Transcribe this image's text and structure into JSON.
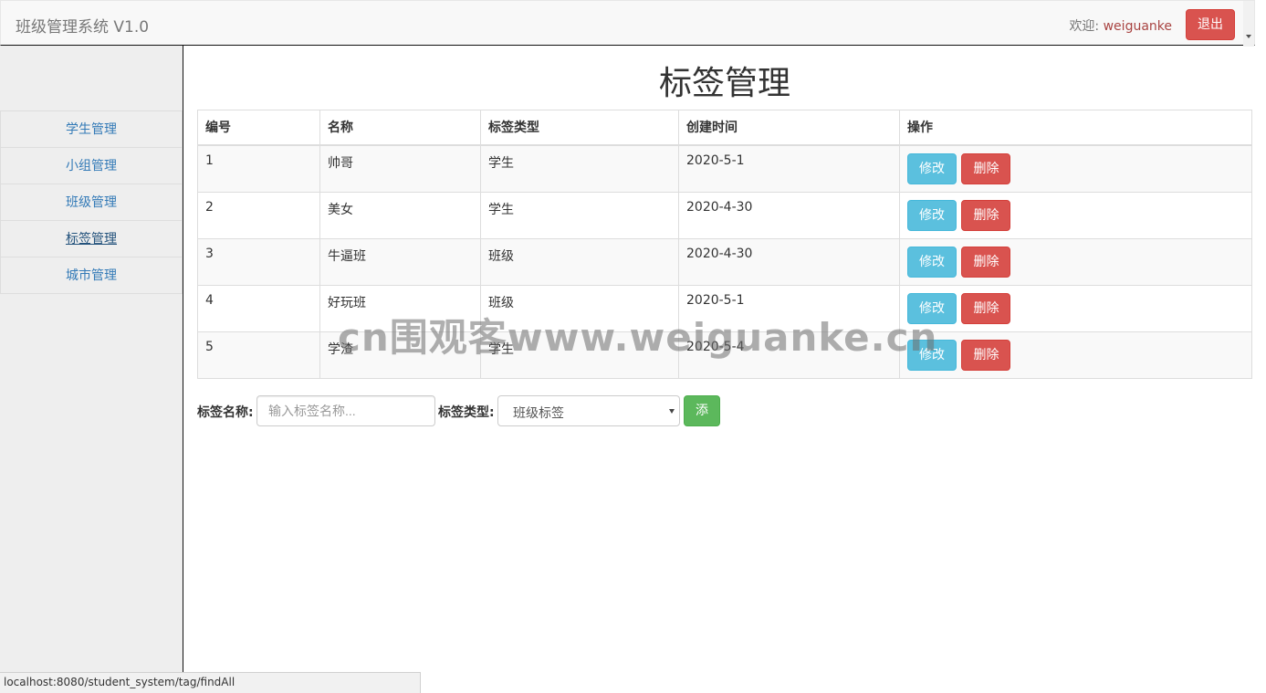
{
  "navbar": {
    "brand": "班级管理系统 V1.0",
    "welcome_prefix": "欢迎: ",
    "username": "weiguanke",
    "logout_label": "退出"
  },
  "sidebar": {
    "items": [
      {
        "label": "学生管理"
      },
      {
        "label": "小组管理"
      },
      {
        "label": "班级管理"
      },
      {
        "label": "标签管理",
        "active": true
      },
      {
        "label": "城市管理"
      }
    ]
  },
  "main": {
    "title": "标签管理",
    "table": {
      "headers": [
        "编号",
        "名称",
        "标签类型",
        "创建时间",
        "操作"
      ],
      "rows": [
        {
          "id": "1",
          "name": "帅哥",
          "type": "学生",
          "created": "2020-5-1"
        },
        {
          "id": "2",
          "name": "美女",
          "type": "学生",
          "created": "2020-4-30"
        },
        {
          "id": "3",
          "name": "牛逼班",
          "type": "班级",
          "created": "2020-4-30"
        },
        {
          "id": "4",
          "name": "好玩班",
          "type": "班级",
          "created": "2020-5-1"
        },
        {
          "id": "5",
          "name": "学渣",
          "type": "学生",
          "created": "2020-5-4"
        }
      ],
      "edit_label": "修改",
      "delete_label": "删除"
    },
    "form": {
      "name_label": "标签名称:",
      "name_placeholder": "输入标签名称...",
      "type_label": "标签类型:",
      "type_selected": "班级标签",
      "add_label": "添加标签"
    }
  },
  "watermark": "cn围观客www.weiguanke.cn",
  "statusbar": "localhost:8080/student_system/tag/findAll",
  "colors": {
    "primary_link": "#337ab7",
    "danger": "#d9534f",
    "info": "#5bc0de",
    "success": "#5cb85c"
  }
}
